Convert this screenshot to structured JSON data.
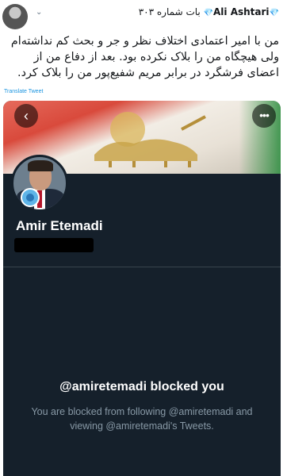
{
  "tweet": {
    "author_prefix": "💎",
    "author_name": "Ali Ashtari",
    "author_suffix": "💎",
    "author_meta": "بات شماره ۳۰۳",
    "caret": "⌄",
    "text": "من با امیر اعتمادی اختلاف نظر و جر و بحث کم نداشته‌ام ولی هیچگاه من را بلاک نکرده بود. بعد از دفاع من از اعضای فرشگرد در برابر مریم شفیع‌پور من را بلاک کرد.",
    "translate_label": "Translate Tweet"
  },
  "profile": {
    "back_icon": "back-arrow-icon",
    "more_icon": "more-options-icon",
    "back_glyph": "‹",
    "more_glyph": "•••",
    "display_name": "Amir Etemadi",
    "handle_redacted": true,
    "blocked_title": "@amiretemadi blocked you",
    "blocked_desc": "You are blocked from following @amiretemadi and viewing @amiretemadi's Tweets."
  },
  "colors": {
    "card_bg": "#15202b",
    "link": "#1b95e0",
    "muted": "#8899a6"
  }
}
